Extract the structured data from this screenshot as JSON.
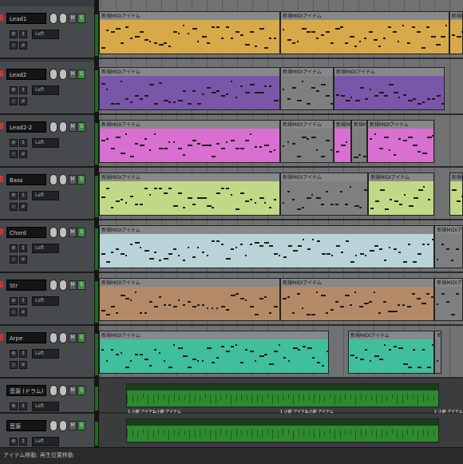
{
  "colors": {
    "audio_green": "#2e8a2e",
    "panel": "#474a4d",
    "arrange_bg": "#6f7173"
  },
  "tracks": [
    {
      "name": "Lead1",
      "input": "Left",
      "color": "#d8a948",
      "items": [
        {
          "label": "新規MIDIアイテム",
          "left_pct": 0,
          "width_pct": 49.8
        },
        {
          "label": "新規MIDIアイテム",
          "left_pct": 49.8,
          "width_pct": 46.4
        },
        {
          "label": "新規MIDIアイテム",
          "left_pct": 96.2,
          "width_pct": 3.8
        }
      ]
    },
    {
      "name": "Lead2",
      "input": "Left",
      "color": "#7a56a8",
      "items": [
        {
          "label": "新規MIDIアイテム",
          "left_pct": 0,
          "width_pct": 49.8
        },
        {
          "label": "新規MIDIアイテム",
          "left_pct": 49.8,
          "width_pct": 14.7,
          "muted": true
        },
        {
          "label": "新規MIDIアイテム",
          "left_pct": 64.5,
          "width_pct": 30.5
        }
      ]
    },
    {
      "name": "Lead2-2",
      "input": "Left",
      "color": "#d96fd0",
      "items": [
        {
          "label": "新規MIDIアイテム",
          "left_pct": 0,
          "width_pct": 49.8
        },
        {
          "label": "新規MIDIアイテム",
          "left_pct": 49.8,
          "width_pct": 14.7,
          "muted": true
        },
        {
          "label": "新規MIDIアイテム",
          "left_pct": 64.5,
          "width_pct": 4.8
        },
        {
          "label": "新規MIDIアイテム",
          "left_pct": 69.3,
          "width_pct": 4.4,
          "muted": true
        },
        {
          "label": "新規MIDIアイテム",
          "left_pct": 73.7,
          "width_pct": 18.5
        }
      ]
    },
    {
      "name": "Bass",
      "input": "Left",
      "color": "#c1d986",
      "items": [
        {
          "label": "新規MIDIアイテム",
          "left_pct": 0,
          "width_pct": 49.8
        },
        {
          "label": "新規MIDIアイテム",
          "left_pct": 49.8,
          "width_pct": 24.2,
          "muted": true
        },
        {
          "label": "新規MIDIアイテム",
          "left_pct": 74.0,
          "width_pct": 18.2
        },
        {
          "label": "新規MIDIアイテム",
          "left_pct": 96.2,
          "width_pct": 3.8
        }
      ]
    },
    {
      "name": "Chord",
      "input": "Left",
      "color": "#b9d4d8",
      "items": [
        {
          "label": "新規MIDIアイテム",
          "left_pct": 0,
          "width_pct": 92.2
        },
        {
          "label": "新規MIDIアイテム",
          "left_pct": 92.2,
          "width_pct": 7.8,
          "muted": true
        }
      ]
    },
    {
      "name": "Str",
      "input": "Left",
      "color": "#b48a66",
      "items": [
        {
          "label": "新規MIDIアイテム",
          "left_pct": 0,
          "width_pct": 49.8
        },
        {
          "label": "新規MIDIアイテム",
          "left_pct": 49.8,
          "width_pct": 42.4
        },
        {
          "label": "新規MIDIアイテム",
          "left_pct": 92.2,
          "width_pct": 7.8,
          "muted": true
        }
      ]
    },
    {
      "name": "Arpe",
      "input": "Left",
      "color": "#3fbf9c",
      "items": [
        {
          "label": "新規MIDIアイテム",
          "left_pct": 0,
          "width_pct": 63.2
        },
        {
          "label": "新規MIDIアイテム",
          "left_pct": 68.4,
          "width_pct": 23.8
        },
        {
          "label": "新規MIDIアイテム",
          "left_pct": 92.2,
          "width_pct": 1.8,
          "muted": true
        }
      ]
    }
  ],
  "audio_tracks": [
    {
      "name": "音源 (ドラム)",
      "input": "Left"
    },
    {
      "name": "音源",
      "input": "Left"
    }
  ],
  "audio_marker_labels": [
    "1 小節 アイテム",
    "1 小節 アイテム",
    "1 小節 アイテム",
    "1 小節 アイテム",
    "1 小節 アイテム"
  ],
  "status": {
    "left": "アイテム移動: 再生位置移動",
    "right": ""
  }
}
